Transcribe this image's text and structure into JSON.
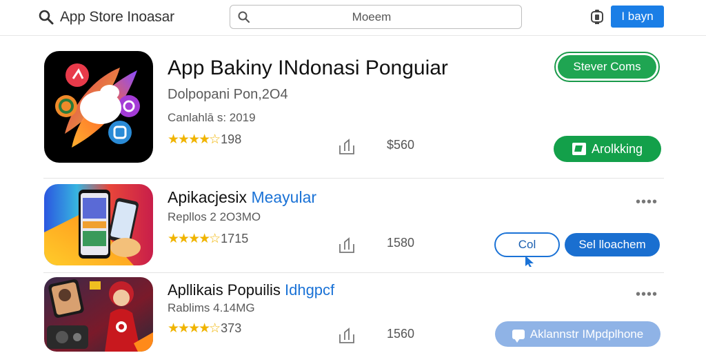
{
  "header": {
    "brand_title": "App Store Inoasar",
    "search_placeholder": "Moeem",
    "buy_label": "I bayn"
  },
  "apps": [
    {
      "title": "App Bakiny INdonasi Ponguiar",
      "subtitle1": "Dolpopani Pon,2O4",
      "subtitle2": "Canlahlā s: 2019",
      "stars": "★★★★☆",
      "rating_count": "198",
      "price": "$560",
      "primary_button": "Stever Coms",
      "secondary_button": "Arolkking"
    },
    {
      "title": "Apikacjesix",
      "title_accent": "Meayular",
      "subtitle1": "Repllos 2 2O3MO",
      "stars": "★★★★☆",
      "rating_count": "1715",
      "price": "1580",
      "more": "••••",
      "outline_button": "Col",
      "primary_button": "Sel lloachem"
    },
    {
      "title": "Apllikais Popuilis",
      "title_accent": "Idhgpcf",
      "subtitle1": "Rablims 4.14MG",
      "stars": "★★★★☆",
      "rating_count": "373",
      "price": "1560",
      "more": "••••",
      "primary_button": "Aklannstr IMpdplhone"
    }
  ],
  "colors": {
    "accent_blue": "#1a72d6",
    "green": "#13a04a",
    "star": "#f0b400"
  }
}
